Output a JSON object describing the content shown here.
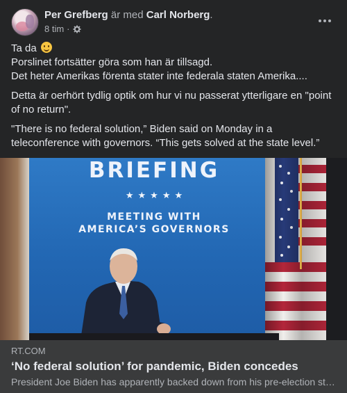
{
  "header": {
    "author": "Per Grefberg",
    "with_text": "är med",
    "tagged": "Carl Norberg",
    "period": ".",
    "time": "8 tim",
    "dot": "·",
    "audience_icon": "gear-icon",
    "more_icon": "more-options-icon"
  },
  "post": {
    "line1": "Ta da",
    "line2": "Porslinet fortsätter göra som han är tillsagd.",
    "line3": "Det heter Amerikas förenta stater inte federala staten Amerika....",
    "para2": "Detta är oerhört tydlig optik om hur vi nu passerat ytterligare en \"point of no return\".",
    "para3": "\"There is no federal solution,” Biden said on Monday in a teleconference with governors. “This gets solved at the state level.”"
  },
  "image": {
    "banner": "BRIEFING",
    "stars": "★★★★★",
    "subtitle_line1": "MEETING WITH",
    "subtitle_line2": "AMERICA’S GOVERNORS"
  },
  "link_preview": {
    "domain": "RT.COM",
    "title": "‘No federal solution’ for pandemic, Biden concedes",
    "snippet": "President Joe Biden has apparently backed down from his pre-election stance on a federal pandemic response"
  },
  "colors": {
    "background": "#242526",
    "link_card": "#3a3b3c",
    "text_primary": "#e4e6eb",
    "text_secondary": "#b0b3b8"
  }
}
